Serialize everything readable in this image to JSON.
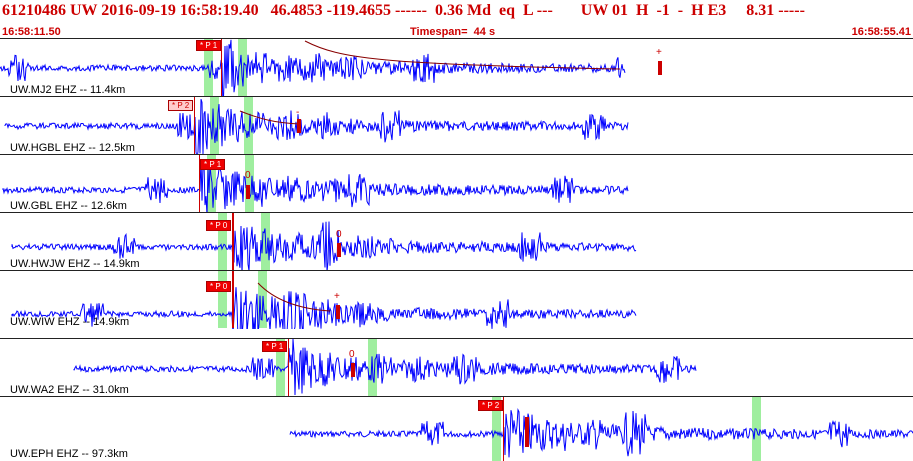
{
  "header": {
    "line": "61210486 UW 2016-09-19 16:58:19.40   46.4853 -119.4655 ------  0.36 Md  eq  L ---       UW 01  H  -1  -  H E3     8.31 -----",
    "start_time": "16:58:11.50",
    "end_time": "16:58:55.41",
    "timespan": "Timespan=  44 s"
  },
  "colors": {
    "trace": "#0000ff",
    "pick": "#ee0000",
    "band": "#7fe87f",
    "header": "#cc0000"
  },
  "panels": [
    {
      "label": "UW.MJ2 EHZ -- 11.4km",
      "pick": "* P 1",
      "pick_alt": false,
      "marker": "+"
    },
    {
      "label": "UW.HGBL EHZ -- 12.5km",
      "pick": "* P 2",
      "pick_alt": true,
      "marker": "-"
    },
    {
      "label": "UW.GBL EHZ -- 12.6km",
      "pick": "* P 1",
      "pick_alt": false,
      "marker": "0"
    },
    {
      "label": "UW.HWJW EHZ -- 14.9km",
      "pick": "* P 0",
      "pick_alt": false,
      "marker": "0"
    },
    {
      "label": "UW.WIW EHZ -- 14.9km",
      "pick": "* P 0",
      "pick_alt": false,
      "marker": "+"
    },
    {
      "label": "UW.WA2 EHZ -- 31.0km",
      "pick": "* P 1",
      "pick_alt": false,
      "marker": "0"
    },
    {
      "label": "UW.EPH EHZ -- 97.3km",
      "pick": "* P 2",
      "pick_alt": false,
      "marker": ""
    }
  ]
}
